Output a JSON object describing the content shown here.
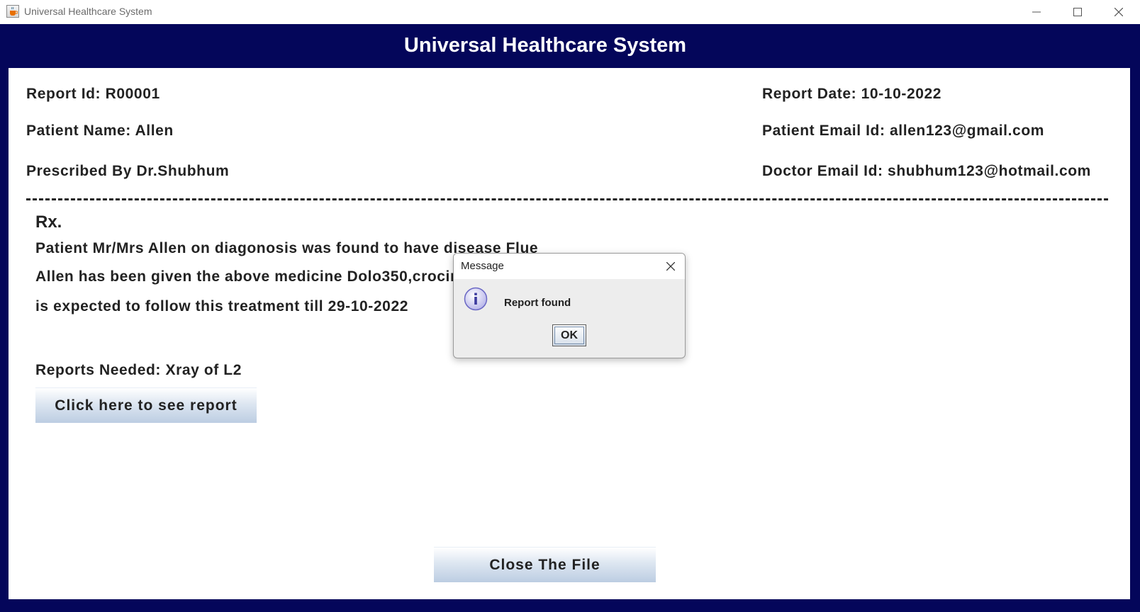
{
  "window": {
    "title": "Universal Healthcare System",
    "icon": "java-cup-icon"
  },
  "header": {
    "title": "Universal Healthcare System"
  },
  "report": {
    "report_id": "Report Id: R00001",
    "report_date": "Report Date: 10-10-2022",
    "patient_name": "Patient Name:  Allen",
    "patient_email": "Patient Email Id: allen123@gmail.com",
    "prescribed_by": "Prescribed By Dr.Shubhum",
    "doctor_email": "Doctor Email Id: shubhum123@hotmail.com",
    "divider": "--------------------------------------------------------------------------------------------------------------------------------------------------------------------------------------",
    "rx_label": "Rx.",
    "line1": "Patient Mr/Mrs  Allen on diagonosis was found to have disease Flue",
    "line2": " Allen has been given the above medicine Dolo350,crocin based on his/her symptoms",
    "line3": "is expected to follow this treatment till 29-10-2022",
    "reports_needed": "Reports Needed: Xray of L2",
    "see_report_button": "Click here to see report",
    "close_button": "Close The File"
  },
  "dialog": {
    "title": "Message",
    "icon": "information-icon",
    "message": "Report found",
    "ok_label": "OK"
  },
  "colors": {
    "frame_navy": "#04065a",
    "button_gradient_bottom": "#bccde2",
    "dialog_bg": "#ededed"
  }
}
